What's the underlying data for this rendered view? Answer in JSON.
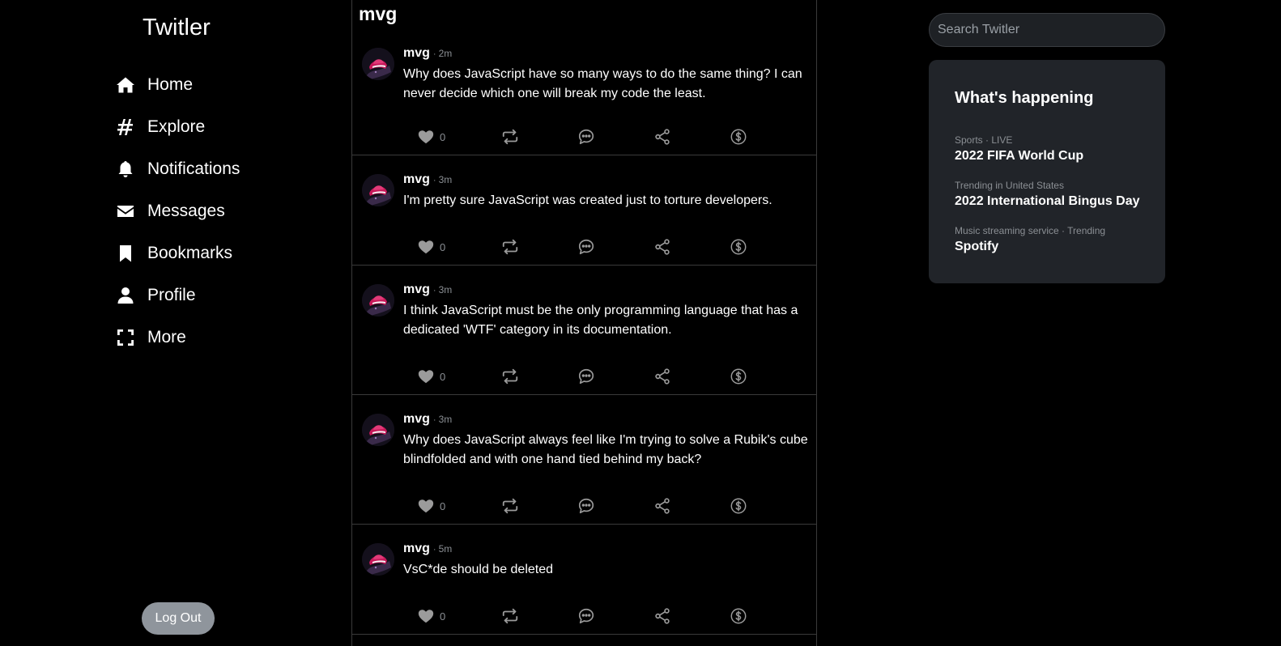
{
  "app": {
    "brand": "Twitler"
  },
  "nav": {
    "items": [
      {
        "label": "Home",
        "icon": "home-icon"
      },
      {
        "label": "Explore",
        "icon": "hashtag-icon"
      },
      {
        "label": "Notifications",
        "icon": "bell-icon"
      },
      {
        "label": "Messages",
        "icon": "envelope-icon"
      },
      {
        "label": "Bookmarks",
        "icon": "bookmark-icon"
      },
      {
        "label": "Profile",
        "icon": "user-icon"
      },
      {
        "label": "More",
        "icon": "expand-icon"
      }
    ],
    "logout_label": "Log Out"
  },
  "feed": {
    "title": "mvg",
    "posts": [
      {
        "author": "mvg",
        "separator": "·",
        "time": "2m",
        "text": "Why does JavaScript have so many ways to do the same thing? I can never decide which one will break my code the least.",
        "likes": "0"
      },
      {
        "author": "mvg",
        "separator": "·",
        "time": "3m",
        "text": "I'm pretty sure JavaScript was created just to torture developers.",
        "likes": "0"
      },
      {
        "author": "mvg",
        "separator": "·",
        "time": "3m",
        "text": "I think JavaScript must be the only programming language that has a dedicated 'WTF' category in its documentation.",
        "likes": "0"
      },
      {
        "author": "mvg",
        "separator": "·",
        "time": "3m",
        "text": "Why does JavaScript always feel like I'm trying to solve a Rubik's cube blindfolded and with one hand tied behind my back?",
        "likes": "0"
      },
      {
        "author": "mvg",
        "separator": "·",
        "time": "5m",
        "text": "VsC*de should be deleted",
        "likes": "0"
      }
    ]
  },
  "search": {
    "placeholder": "Search Twitler"
  },
  "trends": {
    "title": "What's happening",
    "items": [
      {
        "meta": "Sports · LIVE",
        "name": "2022 FIFA World Cup"
      },
      {
        "meta": "Trending in United States",
        "name": "2022 International Bingus Day"
      },
      {
        "meta": "Music streaming service · Trending",
        "name": "Spotify"
      }
    ]
  },
  "colors": {
    "background": "#000000",
    "panel": "#212429",
    "muted": "#8b8f94",
    "action_icon": "#9b9b9b",
    "logout_button": "#8f959c"
  }
}
